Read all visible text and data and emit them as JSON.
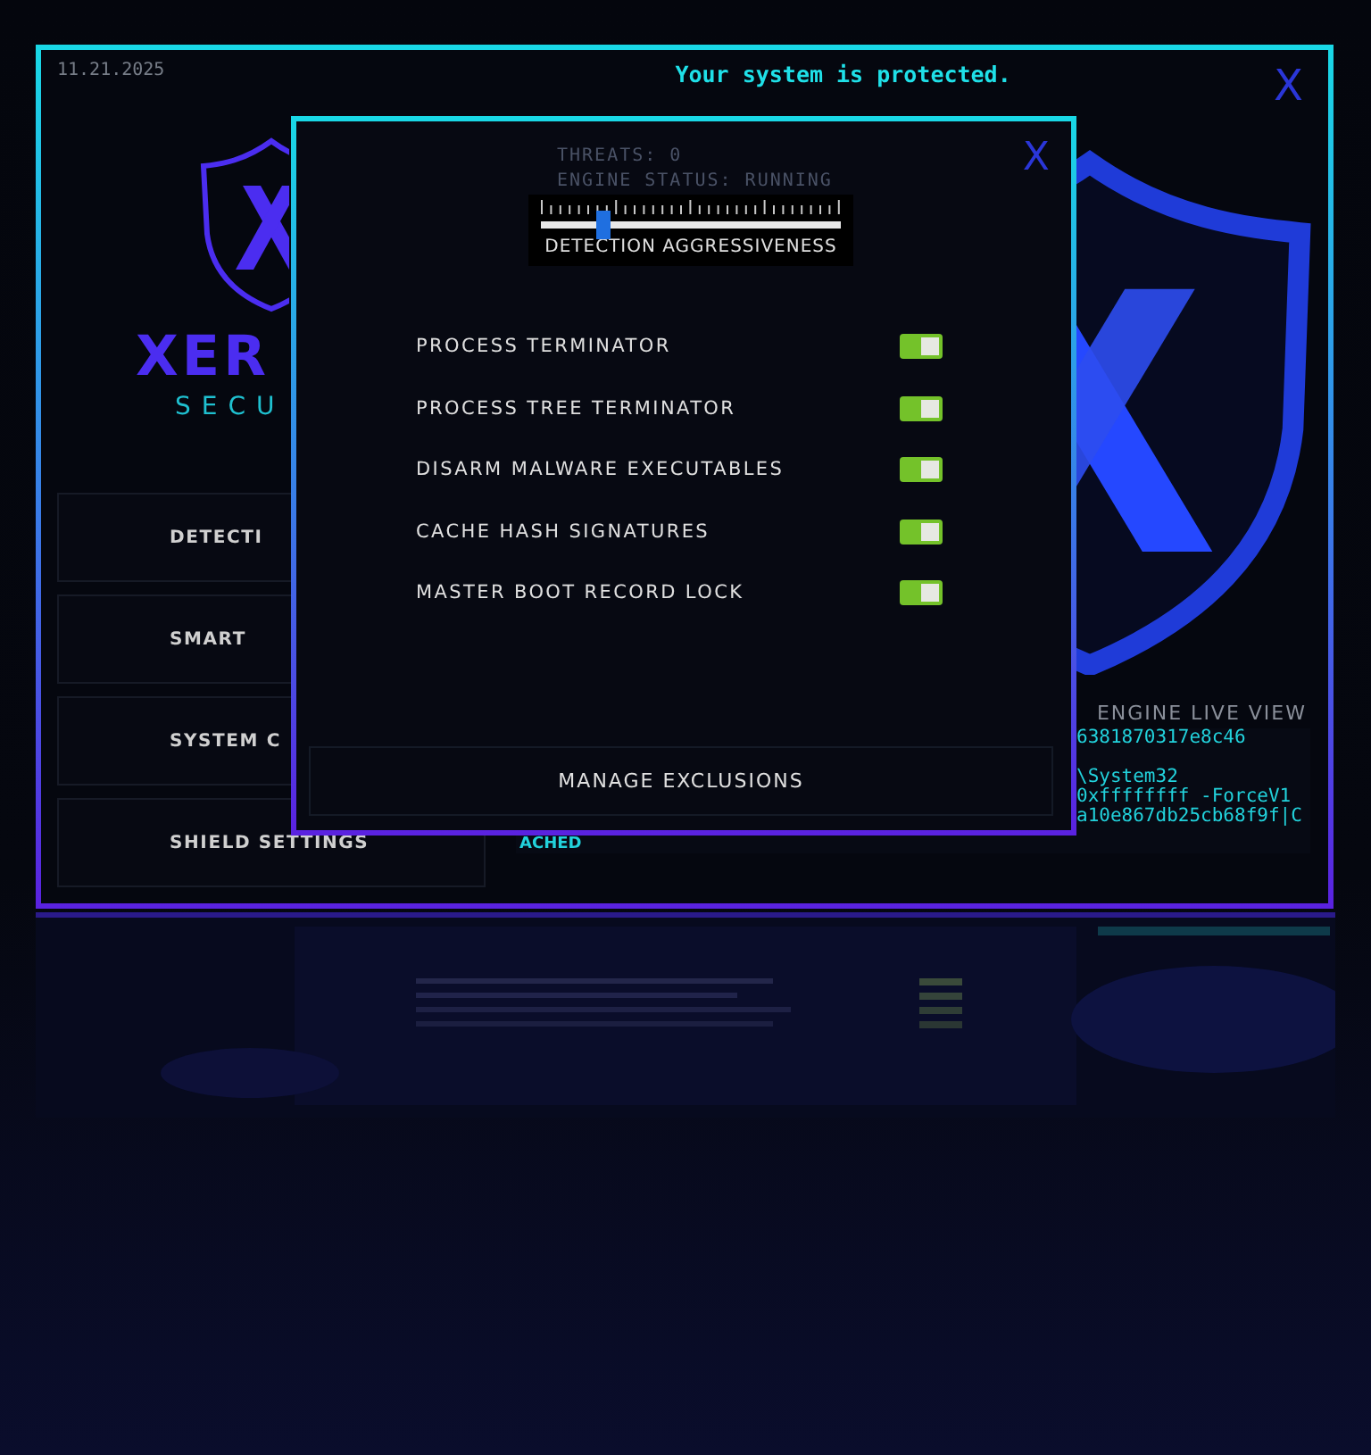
{
  "window": {
    "date": "11.21.2025",
    "status": "Your system is protected.",
    "close": "X"
  },
  "logo": {
    "name": "XER",
    "tagline": "SECU"
  },
  "nav": [
    {
      "label": "DETECTI"
    },
    {
      "label": "SMART"
    },
    {
      "label": "SYSTEM C"
    },
    {
      "label": "SHIELD SETTINGS"
    }
  ],
  "stats": [
    "THREATS: 0",
    "ENGINE STATUS: RUNNING"
  ],
  "live_view": {
    "title": "ENGINE LIVE VIEW",
    "line_groups": [
      [
        "6381870317e8c46"
      ],
      [
        "\\System32",
        "0xffffffff -ForceV1",
        "a10e867db25cb68f9f|C"
      ]
    ],
    "tail": "ACHED"
  },
  "dialog": {
    "close": "X",
    "slider": {
      "label": "DETECTION AGGRESSIVENESS",
      "level": 0.21
    },
    "options": [
      {
        "label": "PROCESS TERMINATOR",
        "on": true
      },
      {
        "label": "PROCESS TREE TERMINATOR",
        "on": true
      },
      {
        "label": "DISARM MALWARE EXECUTABLES",
        "on": true
      },
      {
        "label": "CACHE HASH SIGNATURES",
        "on": true
      },
      {
        "label": "MASTER BOOT RECORD LOCK",
        "on": true
      }
    ],
    "button": "MANAGE EXCLUSIONS"
  }
}
